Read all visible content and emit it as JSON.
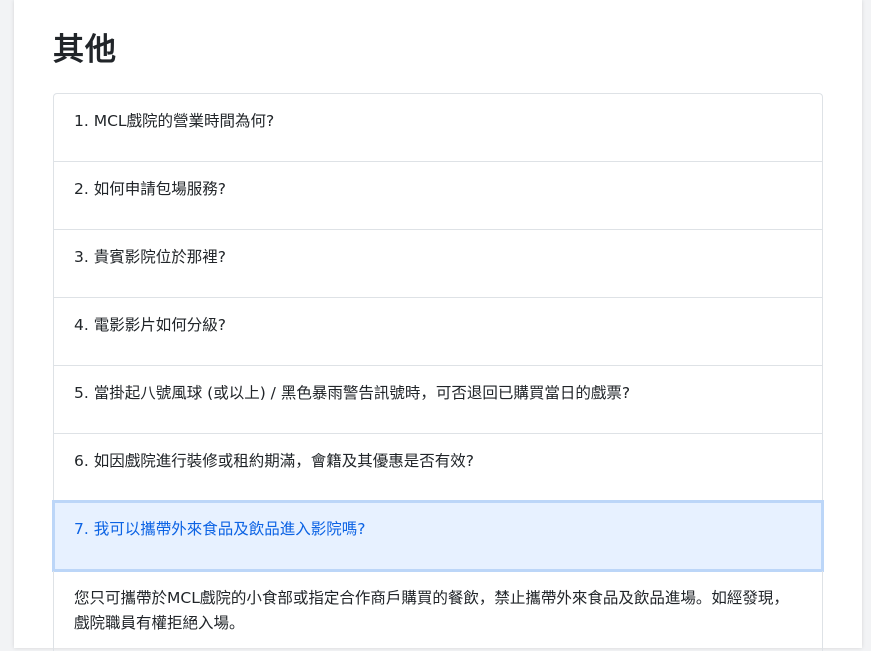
{
  "section": {
    "title": "其他"
  },
  "faq": {
    "items": [
      {
        "question": "1. MCL戲院的營業時間為何?"
      },
      {
        "question": "2. 如何申請包場服務?"
      },
      {
        "question": "3. 貴賓影院位於那裡?"
      },
      {
        "question": "4. 電影影片如何分級?"
      },
      {
        "question": "5. 當掛起八號風球 (或以上) / 黑色暴雨警告訊號時，可否退回已購買當日的戲票?"
      },
      {
        "question": "6. 如因戲院進行裝修或租約期滿，會籍及其優惠是否有效?"
      },
      {
        "question": "7. 我可以攜帶外來食品及飲品進入影院嗎?",
        "expanded": true,
        "answer": "您只可攜帶於MCL戲院的小食部或指定合作商戶購買的餐飲，禁止攜帶外來食品及飲品進場。如經發現，戲院職員有權拒絕入場。"
      }
    ]
  },
  "colors": {
    "active_bg": "#e7f1ff",
    "active_text": "#0c63e4",
    "border": "#dee2e6"
  }
}
